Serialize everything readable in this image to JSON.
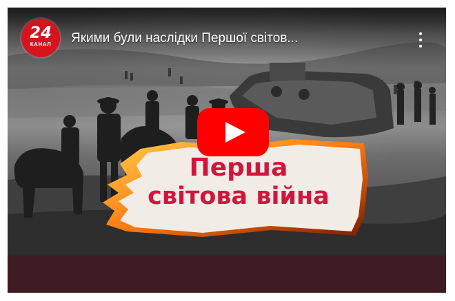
{
  "video": {
    "title": "Якими були наслідки Першої світов...",
    "channel_logo": {
      "number": "24",
      "label": "КАНАЛ"
    },
    "overlay_text": {
      "line1": "Перша",
      "line2": "світова війна"
    },
    "menu_icon": "more-vertical-icon",
    "play_icon": "youtube-play-icon"
  },
  "colors": {
    "bottom_bar": "#3e1a22",
    "logo_red": "#d7141e",
    "play_red": "#ff0000",
    "overlay_text": "#d4143a"
  }
}
